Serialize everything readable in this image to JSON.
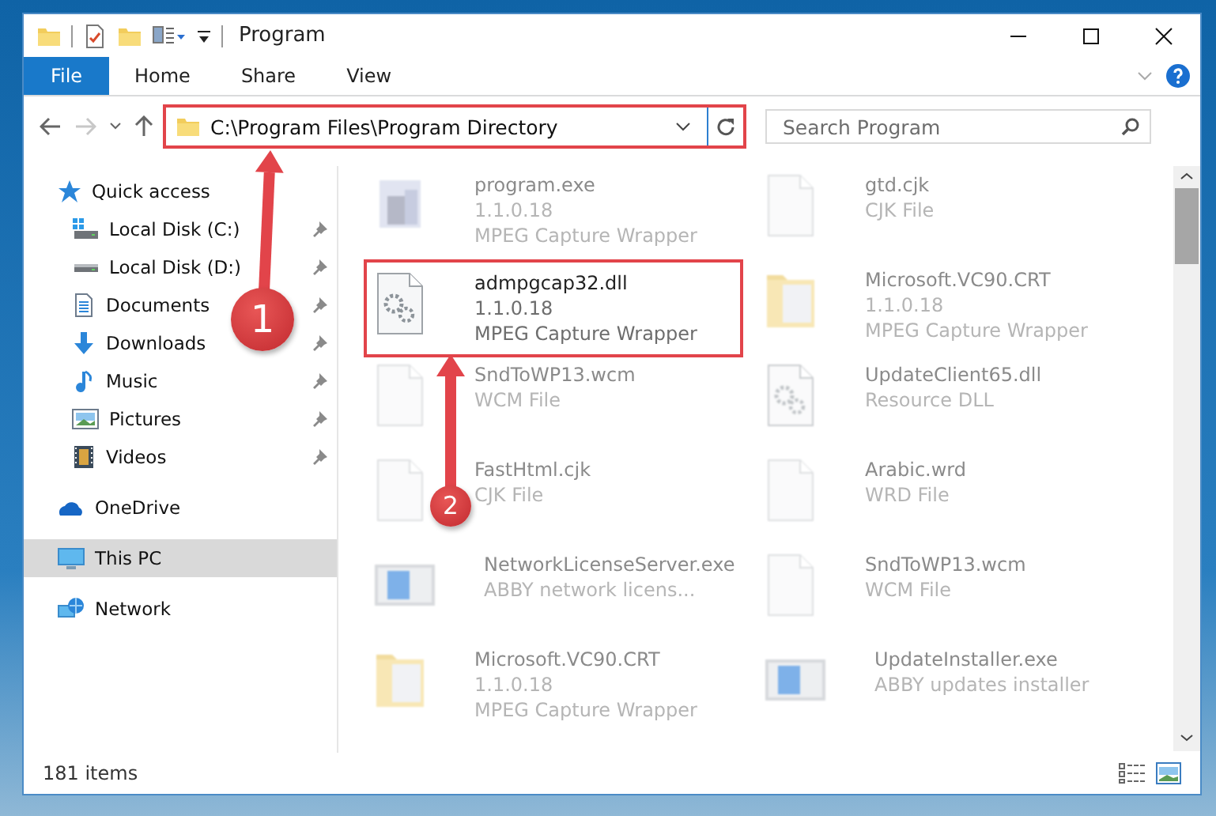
{
  "window": {
    "title": "Program"
  },
  "ribbon": {
    "tabs": [
      {
        "label": "File",
        "selected": true
      },
      {
        "label": "Home",
        "selected": false
      },
      {
        "label": "Share",
        "selected": false
      },
      {
        "label": "View",
        "selected": false
      }
    ]
  },
  "address": {
    "path": "C:\\Program Files\\Program Directory",
    "highlighted": true
  },
  "search": {
    "placeholder": "Search Program"
  },
  "sidebar": {
    "items": [
      {
        "label": "Quick access",
        "kind": "star",
        "selected": false,
        "children": [
          {
            "label": "Local Disk (C:)",
            "kind": "drive-win",
            "pinned": true,
            "selected": false
          },
          {
            "label": "Local Disk (D:)",
            "kind": "drive",
            "pinned": true,
            "selected": false
          },
          {
            "label": "Documents",
            "kind": "documents",
            "pinned": true,
            "selected": false
          },
          {
            "label": "Downloads",
            "kind": "downloads",
            "pinned": true,
            "selected": false
          },
          {
            "label": "Music",
            "kind": "music",
            "pinned": true,
            "selected": false
          },
          {
            "label": "Pictures",
            "kind": "pictures",
            "pinned": true,
            "selected": false
          },
          {
            "label": "Videos",
            "kind": "videos",
            "pinned": true,
            "selected": false
          }
        ]
      },
      {
        "label": "OneDrive",
        "kind": "cloud",
        "selected": false
      },
      {
        "label": "This PC",
        "kind": "pc",
        "selected": true
      },
      {
        "label": "Network",
        "kind": "network",
        "selected": false
      }
    ]
  },
  "files": [
    {
      "name": "program.exe",
      "kind": "exe",
      "blurred": true,
      "highlighted": false,
      "details": [
        "1.1.0.18",
        "MPEG Capture Wrapper"
      ]
    },
    {
      "name": "gtd.cjk",
      "kind": "blank",
      "blurred": true,
      "highlighted": false,
      "details": [
        "CJK File"
      ]
    },
    {
      "name": "admpgcap32.dll",
      "kind": "dll",
      "blurred": false,
      "highlighted": true,
      "details": [
        "1.1.0.18",
        "MPEG Capture Wrapper"
      ]
    },
    {
      "name": "Microsoft.VC90.CRT",
      "kind": "folder",
      "blurred": true,
      "highlighted": false,
      "details": [
        "1.1.0.18",
        "MPEG Capture Wrapper"
      ]
    },
    {
      "name": "SndToWP13.wcm",
      "kind": "blank",
      "blurred": true,
      "highlighted": false,
      "details": [
        "WCM File"
      ]
    },
    {
      "name": "UpdateClient65.dll",
      "kind": "dll",
      "blurred": true,
      "highlighted": false,
      "details": [
        "Resource DLL"
      ]
    },
    {
      "name": "FastHtml.cjk",
      "kind": "blank",
      "blurred": true,
      "highlighted": false,
      "details": [
        "CJK File"
      ]
    },
    {
      "name": "Arabic.wrd",
      "kind": "blank",
      "blurred": true,
      "highlighted": false,
      "details": [
        "WRD File"
      ]
    },
    {
      "name": "NetworkLicenseServer.exe",
      "kind": "app",
      "blurred": true,
      "highlighted": false,
      "details": [
        "ABBY network licens..."
      ]
    },
    {
      "name": "SndToWP13.wcm",
      "kind": "blank",
      "blurred": true,
      "highlighted": false,
      "details": [
        "WCM File"
      ]
    },
    {
      "name": "Microsoft.VC90.CRT",
      "kind": "folder",
      "blurred": true,
      "highlighted": false,
      "details": [
        "1.1.0.18",
        "MPEG Capture Wrapper"
      ]
    },
    {
      "name": "UpdateInstaller.exe",
      "kind": "app",
      "blurred": true,
      "highlighted": false,
      "details": [
        "ABBY updates installer"
      ]
    }
  ],
  "status_bar": {
    "item_count": "181 items"
  },
  "annotations": [
    {
      "number": "1"
    },
    {
      "number": "2"
    }
  ]
}
